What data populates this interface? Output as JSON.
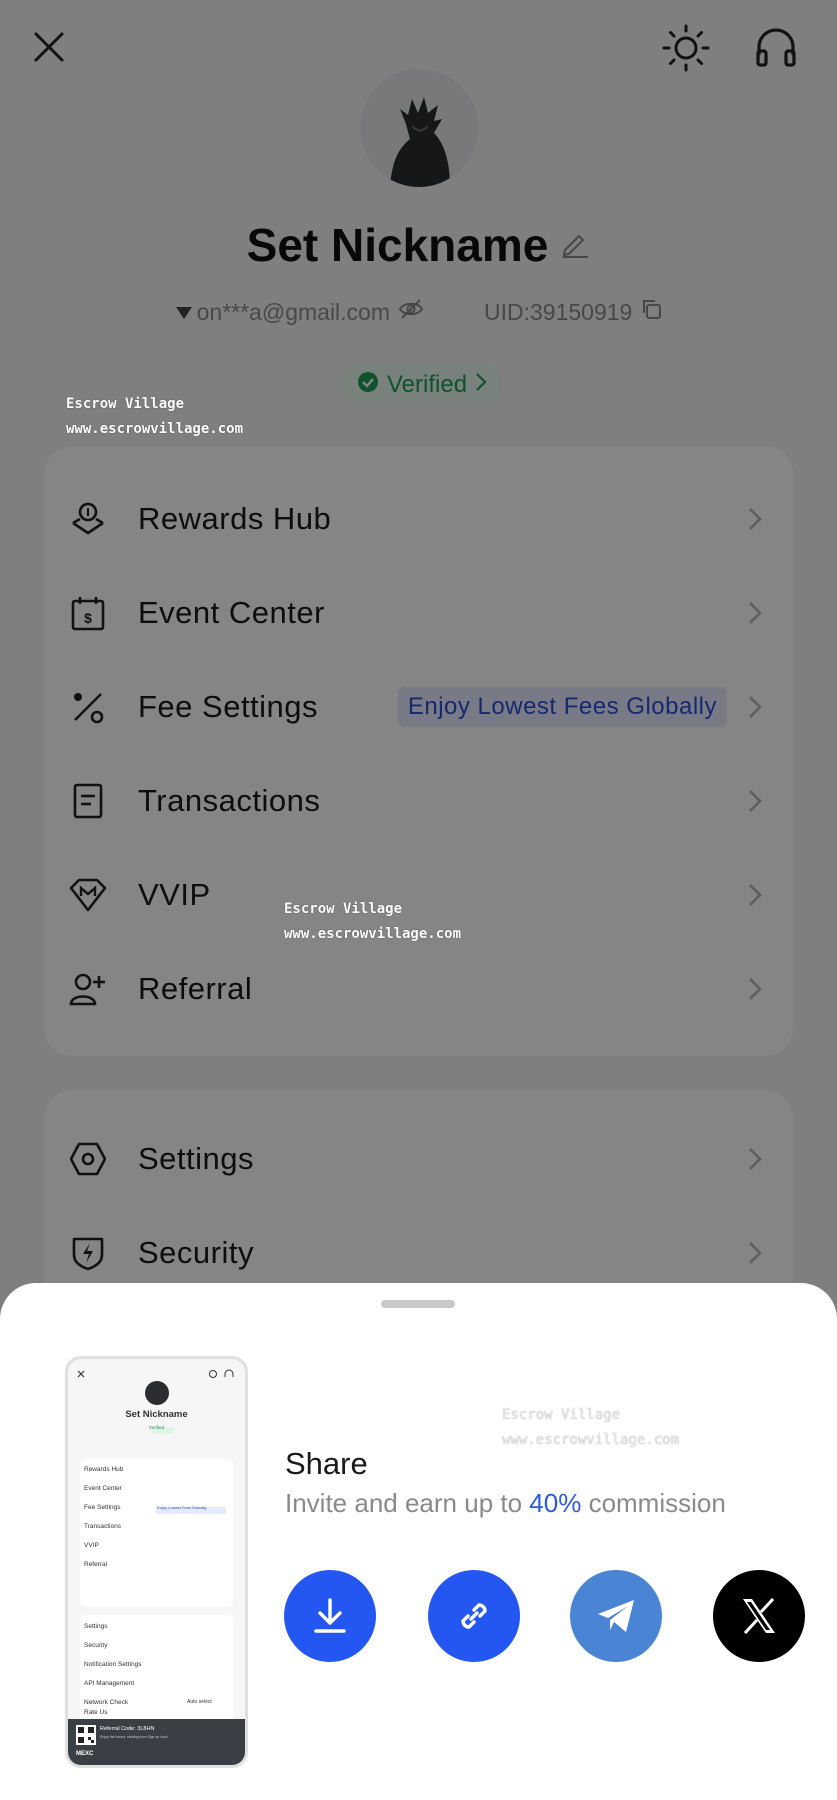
{
  "header": {
    "close_icon": "close-icon",
    "theme_icon": "sun-icon",
    "support_icon": "headset-icon"
  },
  "profile": {
    "nickname": "Set Nickname",
    "email": "on***a@gmail.com",
    "uid": "UID:39150919",
    "verified_label": "Verified"
  },
  "menu_main": [
    {
      "label": "Rewards Hub",
      "icon": "rewards-icon"
    },
    {
      "label": "Event Center",
      "icon": "calendar-dollar-icon"
    },
    {
      "label": "Fee Settings",
      "icon": "percent-icon",
      "badge": "Enjoy Lowest Fees Globally"
    },
    {
      "label": "Transactions",
      "icon": "document-icon"
    },
    {
      "label": "VVIP",
      "icon": "vvip-gem-icon"
    },
    {
      "label": "Referral",
      "icon": "add-user-icon"
    }
  ],
  "menu_secondary": [
    {
      "label": "Settings",
      "icon": "settings-hex-icon"
    },
    {
      "label": "Security",
      "icon": "shield-bolt-icon"
    }
  ],
  "watermarks": [
    {
      "line1": "Escrow Village",
      "line2": "www.escrowvillage.com"
    },
    {
      "line1": "Escrow Village",
      "line2": "www.escrowvillage.com"
    },
    {
      "line1": "Escrow Village",
      "line2": "www.escrowvillage.com"
    }
  ],
  "share_sheet": {
    "title": "Share",
    "subtitle_pre": "Invite and earn up to ",
    "subtitle_highlight": "40%",
    "subtitle_post": " commission",
    "buttons": [
      {
        "name": "download",
        "icon": "download-icon",
        "color": "#2456f2"
      },
      {
        "name": "copy-link",
        "icon": "link-icon",
        "color": "#2456f2"
      },
      {
        "name": "telegram",
        "icon": "telegram-icon",
        "color": "#4a84d4"
      },
      {
        "name": "x",
        "icon": "x-logo-icon",
        "color": "#000000"
      }
    ]
  },
  "preview": {
    "nickname": "Set Nickname",
    "verified": "Verified",
    "rows": [
      "Rewards Hub",
      "Event Center",
      "Fee Settings",
      "Transactions",
      "VVIP",
      "Referral",
      "Settings",
      "Security",
      "Notification Settings",
      "API Management",
      "Network Check",
      "Rate Us"
    ],
    "fee_badge": "Enjoy Lowest Fees Globally",
    "network_value": "Auto select",
    "referral_code": "Referral Code: 3L8HN",
    "referral_sub": "Enjoy the bonus, starting from Sign up now!",
    "brand": "MEXC"
  },
  "colors": {
    "accent": "#2456f2",
    "verified_green": "#1f9d55",
    "promo_bg": "#e6ebff"
  }
}
